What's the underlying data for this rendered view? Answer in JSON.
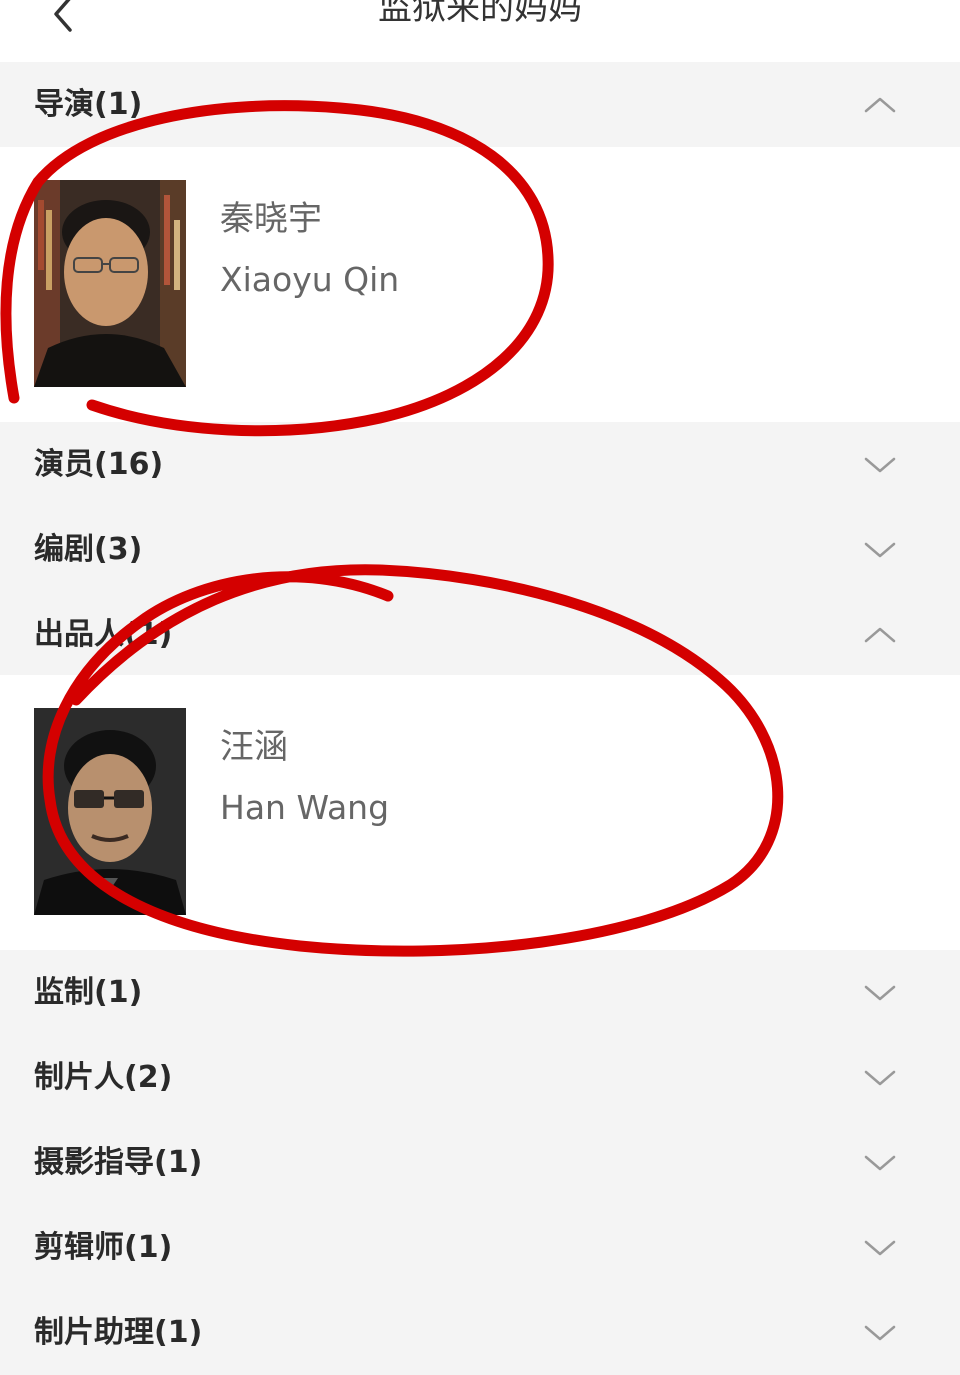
{
  "header": {
    "title": "监狱来的妈妈",
    "back_icon": "chevron-left-icon"
  },
  "sections": [
    {
      "label": "导演(1)",
      "state": "expanded",
      "people": [
        {
          "name_cn": "秦晓宇",
          "name_en": "Xiaoyu Qin"
        }
      ]
    },
    {
      "label": "演员(16)",
      "state": "collapsed"
    },
    {
      "label": "编剧(3)",
      "state": "collapsed"
    },
    {
      "label": "出品人(1)",
      "state": "expanded",
      "people": [
        {
          "name_cn": "汪涵",
          "name_en": "Han Wang"
        }
      ]
    },
    {
      "label": "监制(1)",
      "state": "collapsed"
    },
    {
      "label": "制片人(2)",
      "state": "collapsed"
    },
    {
      "label": "摄影指导(1)",
      "state": "collapsed"
    },
    {
      "label": "剪辑师(1)",
      "state": "collapsed"
    },
    {
      "label": "制片助理(1)",
      "state": "collapsed"
    }
  ],
  "colors": {
    "annotation": "#d40000",
    "background": "#f4f4f4",
    "card": "#ffffff"
  }
}
